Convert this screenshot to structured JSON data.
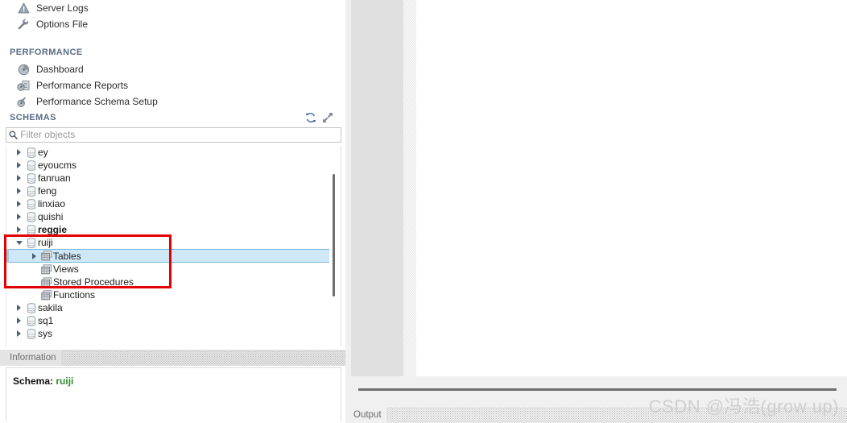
{
  "navigator": {
    "management_items": [
      {
        "label": "Server Logs",
        "icon": "warning-triangle-icon"
      },
      {
        "label": "Options File",
        "icon": "wrench-icon"
      }
    ],
    "performance_section": {
      "title": "PERFORMANCE",
      "items": [
        {
          "label": "Dashboard",
          "icon": "gauge-icon"
        },
        {
          "label": "Performance Reports",
          "icon": "gauge-report-icon"
        },
        {
          "label": "Performance Schema Setup",
          "icon": "gauge-wrench-icon"
        }
      ]
    },
    "schemas_section": {
      "title": "SCHEMAS",
      "refresh_icon": "refresh-icon",
      "expand_icon": "expand-arrows-icon",
      "filter": {
        "placeholder": "Filter objects",
        "value": "",
        "icon": "search-icon"
      },
      "tree": [
        {
          "label": "ey",
          "icon": "schema-icon",
          "level": 0,
          "state": "collapsed",
          "bold": false,
          "selected": false
        },
        {
          "label": "eyoucms",
          "icon": "schema-icon",
          "level": 0,
          "state": "collapsed",
          "bold": false,
          "selected": false
        },
        {
          "label": "fanruan",
          "icon": "schema-icon",
          "level": 0,
          "state": "collapsed",
          "bold": false,
          "selected": false
        },
        {
          "label": "feng",
          "icon": "schema-icon",
          "level": 0,
          "state": "collapsed",
          "bold": false,
          "selected": false
        },
        {
          "label": "linxiao",
          "icon": "schema-icon",
          "level": 0,
          "state": "collapsed",
          "bold": false,
          "selected": false
        },
        {
          "label": "quishi",
          "icon": "schema-icon",
          "level": 0,
          "state": "collapsed",
          "bold": false,
          "selected": false
        },
        {
          "label": "reggie",
          "icon": "schema-icon",
          "level": 0,
          "state": "collapsed",
          "bold": true,
          "selected": false
        },
        {
          "label": "ruiji",
          "icon": "schema-icon",
          "level": 0,
          "state": "expanded",
          "bold": false,
          "selected": false
        },
        {
          "label": "Tables",
          "icon": "table-group-icon",
          "level": 1,
          "state": "collapsed",
          "bold": false,
          "selected": true
        },
        {
          "label": "Views",
          "icon": "table-group-icon",
          "level": 1,
          "state": "leaf",
          "bold": false,
          "selected": false
        },
        {
          "label": "Stored Procedures",
          "icon": "table-group-icon",
          "level": 1,
          "state": "leaf",
          "bold": false,
          "selected": false
        },
        {
          "label": "Functions",
          "icon": "table-group-icon",
          "level": 1,
          "state": "leaf",
          "bold": false,
          "selected": false
        },
        {
          "label": "sakila",
          "icon": "schema-icon",
          "level": 0,
          "state": "collapsed",
          "bold": false,
          "selected": false
        },
        {
          "label": "sq1",
          "icon": "schema-icon",
          "level": 0,
          "state": "collapsed",
          "bold": false,
          "selected": false
        },
        {
          "label": "sys",
          "icon": "schema-icon",
          "level": 0,
          "state": "collapsed",
          "bold": false,
          "selected": false
        }
      ]
    },
    "information_panel": {
      "title": "Information",
      "label": "Schema:",
      "schema_name": "ruiji",
      "schema_name_color": "#2e8b2e"
    }
  },
  "output_panel": {
    "title": "Output"
  },
  "annotation": {
    "red_box_color": "#e30000"
  },
  "watermark": {
    "text": "CSDN @冯浩(grow up)"
  }
}
